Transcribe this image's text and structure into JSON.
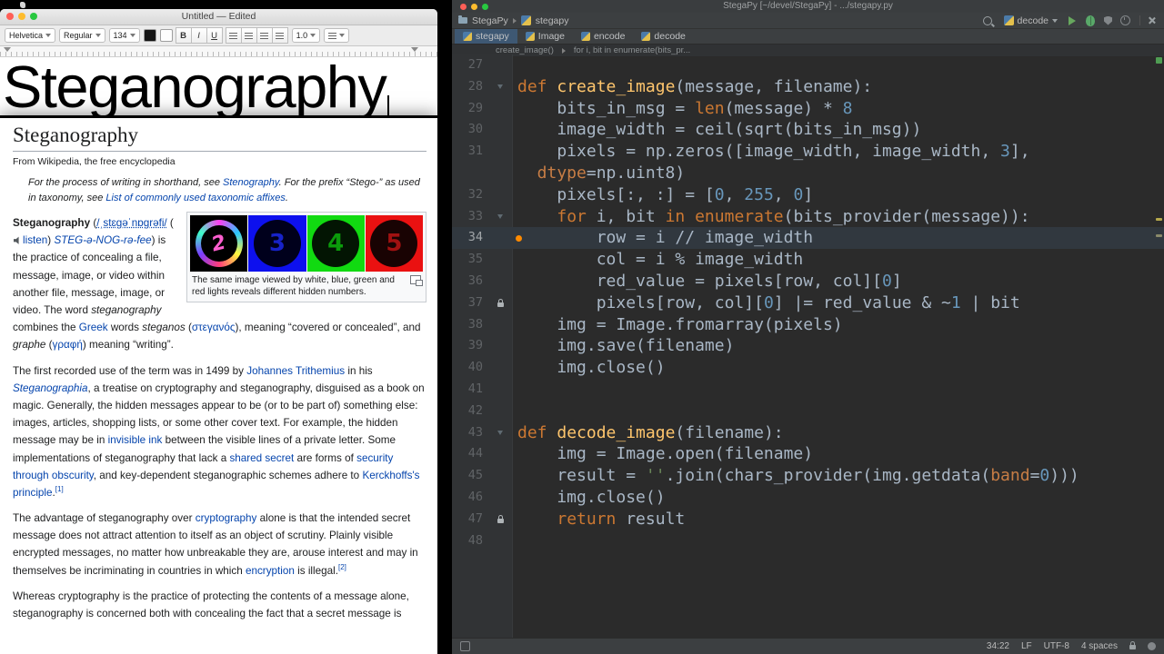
{
  "palette": {
    "editor_bg": "#2B2B2B",
    "keyword": "#CC7832",
    "function_def": "#FFC66D",
    "number": "#6897BB",
    "string": "#6A8759",
    "named_arg": "#C77D45",
    "wiki_link": "#0645AD",
    "active_tab": "#3E5873",
    "marker_dot": "#FF8A00"
  },
  "textedit": {
    "window_title": "Untitled — Edited",
    "toolbar": {
      "font_family": "Helvetica",
      "font_style": "Regular",
      "font_size": "134",
      "bold_label": "B",
      "italic_label": "I",
      "underline_label": "U",
      "line_spacing": "1.0"
    },
    "document_text": "Steganography"
  },
  "wiki": {
    "title": "Steganography",
    "tagline": "From Wikipedia, the free encyclopedia",
    "hatnote": [
      {
        "t": "For the process of writing in shorthand, see ",
        "s": "i"
      },
      {
        "t": "Stenography",
        "s": "i link"
      },
      {
        "t": ". For the prefix “Stego-” as used in taxonomy, see ",
        "s": "i"
      },
      {
        "t": "List of commonly used taxonomic affixes",
        "s": "i link"
      },
      {
        "t": ".",
        "s": "i"
      }
    ],
    "thumb": {
      "panels": [
        {
          "digit": "2"
        },
        {
          "digit": "3"
        },
        {
          "digit": "4"
        },
        {
          "digit": "5"
        }
      ],
      "caption": "The same image viewed by white, blue, green and red lights reveals different hidden numbers."
    },
    "paragraphs": {
      "p1": [
        {
          "t": "Steganography",
          "s": "b"
        },
        {
          "t": " (",
          "s": ""
        },
        {
          "t": "/ˌstɛɡəˈnɒɡrəfi/",
          "s": "ipa"
        },
        {
          "t": " (",
          "s": ""
        },
        {
          "t": "",
          "s": "spk"
        },
        {
          "t": "listen",
          "s": "link"
        },
        {
          "t": ") ",
          "s": ""
        },
        {
          "t": "STEG-ə-NOG-rə-fee",
          "s": "link i"
        },
        {
          "t": ") is the practice of concealing a file, message, image, or video within another file, message, image, or video. The word ",
          "s": ""
        },
        {
          "t": "steganography",
          "s": "i"
        },
        {
          "t": " combines the ",
          "s": ""
        },
        {
          "t": "Greek",
          "s": "link"
        },
        {
          "t": " words ",
          "s": ""
        },
        {
          "t": "steganos",
          "s": "i"
        },
        {
          "t": " (",
          "s": ""
        },
        {
          "t": "στεγανός",
          "s": "link"
        },
        {
          "t": "), meaning “covered or concealed”, and ",
          "s": ""
        },
        {
          "t": "graphe",
          "s": "i"
        },
        {
          "t": " (",
          "s": ""
        },
        {
          "t": "γραφή",
          "s": "link"
        },
        {
          "t": ") meaning “writing”.",
          "s": ""
        }
      ],
      "p2": [
        {
          "t": "The first recorded use of the term was in 1499 by ",
          "s": ""
        },
        {
          "t": "Johannes Trithemius",
          "s": "link"
        },
        {
          "t": " in his ",
          "s": ""
        },
        {
          "t": "Steganographia",
          "s": "link i"
        },
        {
          "t": ", a treatise on cryptography and steganography, disguised as a book on magic. Generally, the hidden messages appear to be (or to be part of) something else: images, articles, shopping lists, or some other cover text. For example, the hidden message may be in ",
          "s": ""
        },
        {
          "t": "invisible ink",
          "s": "link"
        },
        {
          "t": " between the visible lines of a private letter. Some implementations of steganography that lack a ",
          "s": ""
        },
        {
          "t": "shared secret",
          "s": "link"
        },
        {
          "t": " are forms of ",
          "s": ""
        },
        {
          "t": "security through obscurity",
          "s": "link"
        },
        {
          "t": ", and key-dependent steganographic schemes adhere to ",
          "s": ""
        },
        {
          "t": "Kerckhoffs's principle",
          "s": "link"
        },
        {
          "t": ".",
          "s": ""
        },
        {
          "t": "[1]",
          "s": "sup link"
        }
      ],
      "p3": [
        {
          "t": "The advantage of steganography over ",
          "s": ""
        },
        {
          "t": "cryptography",
          "s": "link"
        },
        {
          "t": " alone is that the intended secret message does not attract attention to itself as an object of scrutiny. Plainly visible encrypted messages, no matter how unbreakable they are, arouse interest and may in themselves be incriminating in countries in which ",
          "s": ""
        },
        {
          "t": "encryption",
          "s": "link"
        },
        {
          "t": " is illegal.",
          "s": ""
        },
        {
          "t": "[2]",
          "s": "sup link"
        }
      ],
      "p4": [
        {
          "t": "Whereas cryptography is the practice of protecting the contents of a message alone, steganography is concerned both with concealing the fact that a secret message is",
          "s": ""
        }
      ]
    }
  },
  "pycharm": {
    "window_title": "StegaPy [~/devel/StegaPy] - .../stegapy.py",
    "navbar": {
      "project": "StegaPy",
      "module": "stegapy"
    },
    "run_config": "decode",
    "tabs": [
      {
        "label": "stegapy",
        "active": true
      },
      {
        "label": "Image",
        "active": false
      },
      {
        "label": "encode",
        "active": false
      },
      {
        "label": "decode",
        "active": false
      }
    ],
    "breadcrumbs": {
      "first": "create_image()",
      "second": "for i, bit in enumerate(bits_pr..."
    },
    "editor": {
      "lines": [
        {
          "num": "27",
          "tokens": []
        },
        {
          "num": "28",
          "mark": "fold",
          "tokens": [
            [
              "kw",
              "def "
            ],
            [
              "fn",
              "create_image"
            ],
            [
              "pl",
              "(message, filename):"
            ]
          ]
        },
        {
          "num": "29",
          "tokens": [
            [
              "pl",
              "    bits_in_msg = "
            ],
            [
              "bi",
              "len"
            ],
            [
              "pl",
              "(message) * "
            ],
            [
              "num",
              "8"
            ]
          ]
        },
        {
          "num": "30",
          "tokens": [
            [
              "pl",
              "    image_width = ceil(sqrt(bits_in_msg))"
            ]
          ]
        },
        {
          "num": "31",
          "tokens": [
            [
              "pl",
              "    pixels = np.zeros([image_width, image_width, "
            ],
            [
              "num",
              "3"
            ],
            [
              "pl",
              "],"
            ]
          ]
        },
        {
          "num": "",
          "tokens": [
            [
              "na",
              "  dtype"
            ],
            [
              "pl",
              "="
            ],
            [
              "pl",
              "np.uint8)"
            ]
          ]
        },
        {
          "num": "32",
          "tokens": [
            [
              "pl",
              "    pixels[:, :] = ["
            ],
            [
              "num",
              "0"
            ],
            [
              "pl",
              ", "
            ],
            [
              "num",
              "255"
            ],
            [
              "pl",
              ", "
            ],
            [
              "num",
              "0"
            ],
            [
              "pl",
              "]"
            ]
          ]
        },
        {
          "num": "33",
          "mark": "fold",
          "tokens": [
            [
              "pl",
              "    "
            ],
            [
              "kw",
              "for "
            ],
            [
              "pl",
              "i, bit "
            ],
            [
              "kw",
              "in "
            ],
            [
              "bi",
              "enumerate"
            ],
            [
              "pl",
              "(bits_provider(message)):"
            ]
          ]
        },
        {
          "num": "34",
          "current": true,
          "dot": true,
          "tokens": [
            [
              "pl",
              "        row = i // image_width"
            ]
          ]
        },
        {
          "num": "35",
          "tokens": [
            [
              "pl",
              "        col = i % image_width"
            ]
          ]
        },
        {
          "num": "36",
          "tokens": [
            [
              "pl",
              "        red_value = pixels[row, col]["
            ],
            [
              "num",
              "0"
            ],
            [
              "pl",
              "]"
            ]
          ]
        },
        {
          "num": "37",
          "mark": "lock",
          "tokens": [
            [
              "pl",
              "        pixels[row, col]["
            ],
            [
              "num",
              "0"
            ],
            [
              "pl",
              "] |= red_value & ~"
            ],
            [
              "num",
              "1"
            ],
            [
              "pl",
              " | bit"
            ]
          ]
        },
        {
          "num": "38",
          "tokens": [
            [
              "pl",
              "    img = Image.fromarray(pixels)"
            ]
          ]
        },
        {
          "num": "39",
          "tokens": [
            [
              "pl",
              "    img.save(filename)"
            ]
          ]
        },
        {
          "num": "40",
          "tokens": [
            [
              "pl",
              "    img.close()"
            ]
          ]
        },
        {
          "num": "41",
          "tokens": []
        },
        {
          "num": "42",
          "tokens": []
        },
        {
          "num": "43",
          "mark": "fold",
          "tokens": [
            [
              "kw",
              "def "
            ],
            [
              "fn",
              "decode_image"
            ],
            [
              "pl",
              "(filename):"
            ]
          ]
        },
        {
          "num": "44",
          "tokens": [
            [
              "pl",
              "    img = Image.open(filename)"
            ]
          ]
        },
        {
          "num": "45",
          "tokens": [
            [
              "pl",
              "    result = "
            ],
            [
              "str",
              "''"
            ],
            [
              "pl",
              ".join(chars_provider(img.getdata("
            ],
            [
              "na",
              "band"
            ],
            [
              "pl",
              "="
            ],
            [
              "num",
              "0"
            ],
            [
              "pl",
              ")))"
            ]
          ]
        },
        {
          "num": "46",
          "tokens": [
            [
              "pl",
              "    img.close()"
            ]
          ]
        },
        {
          "num": "47",
          "mark": "lock",
          "tokens": [
            [
              "pl",
              "    "
            ],
            [
              "kw",
              "return "
            ],
            [
              "pl",
              "result"
            ]
          ]
        },
        {
          "num": "48",
          "tokens": []
        }
      ]
    },
    "status": {
      "caret": "34:22",
      "line_sep": "LF",
      "encoding": "UTF-8",
      "indent": "4 spaces"
    }
  }
}
